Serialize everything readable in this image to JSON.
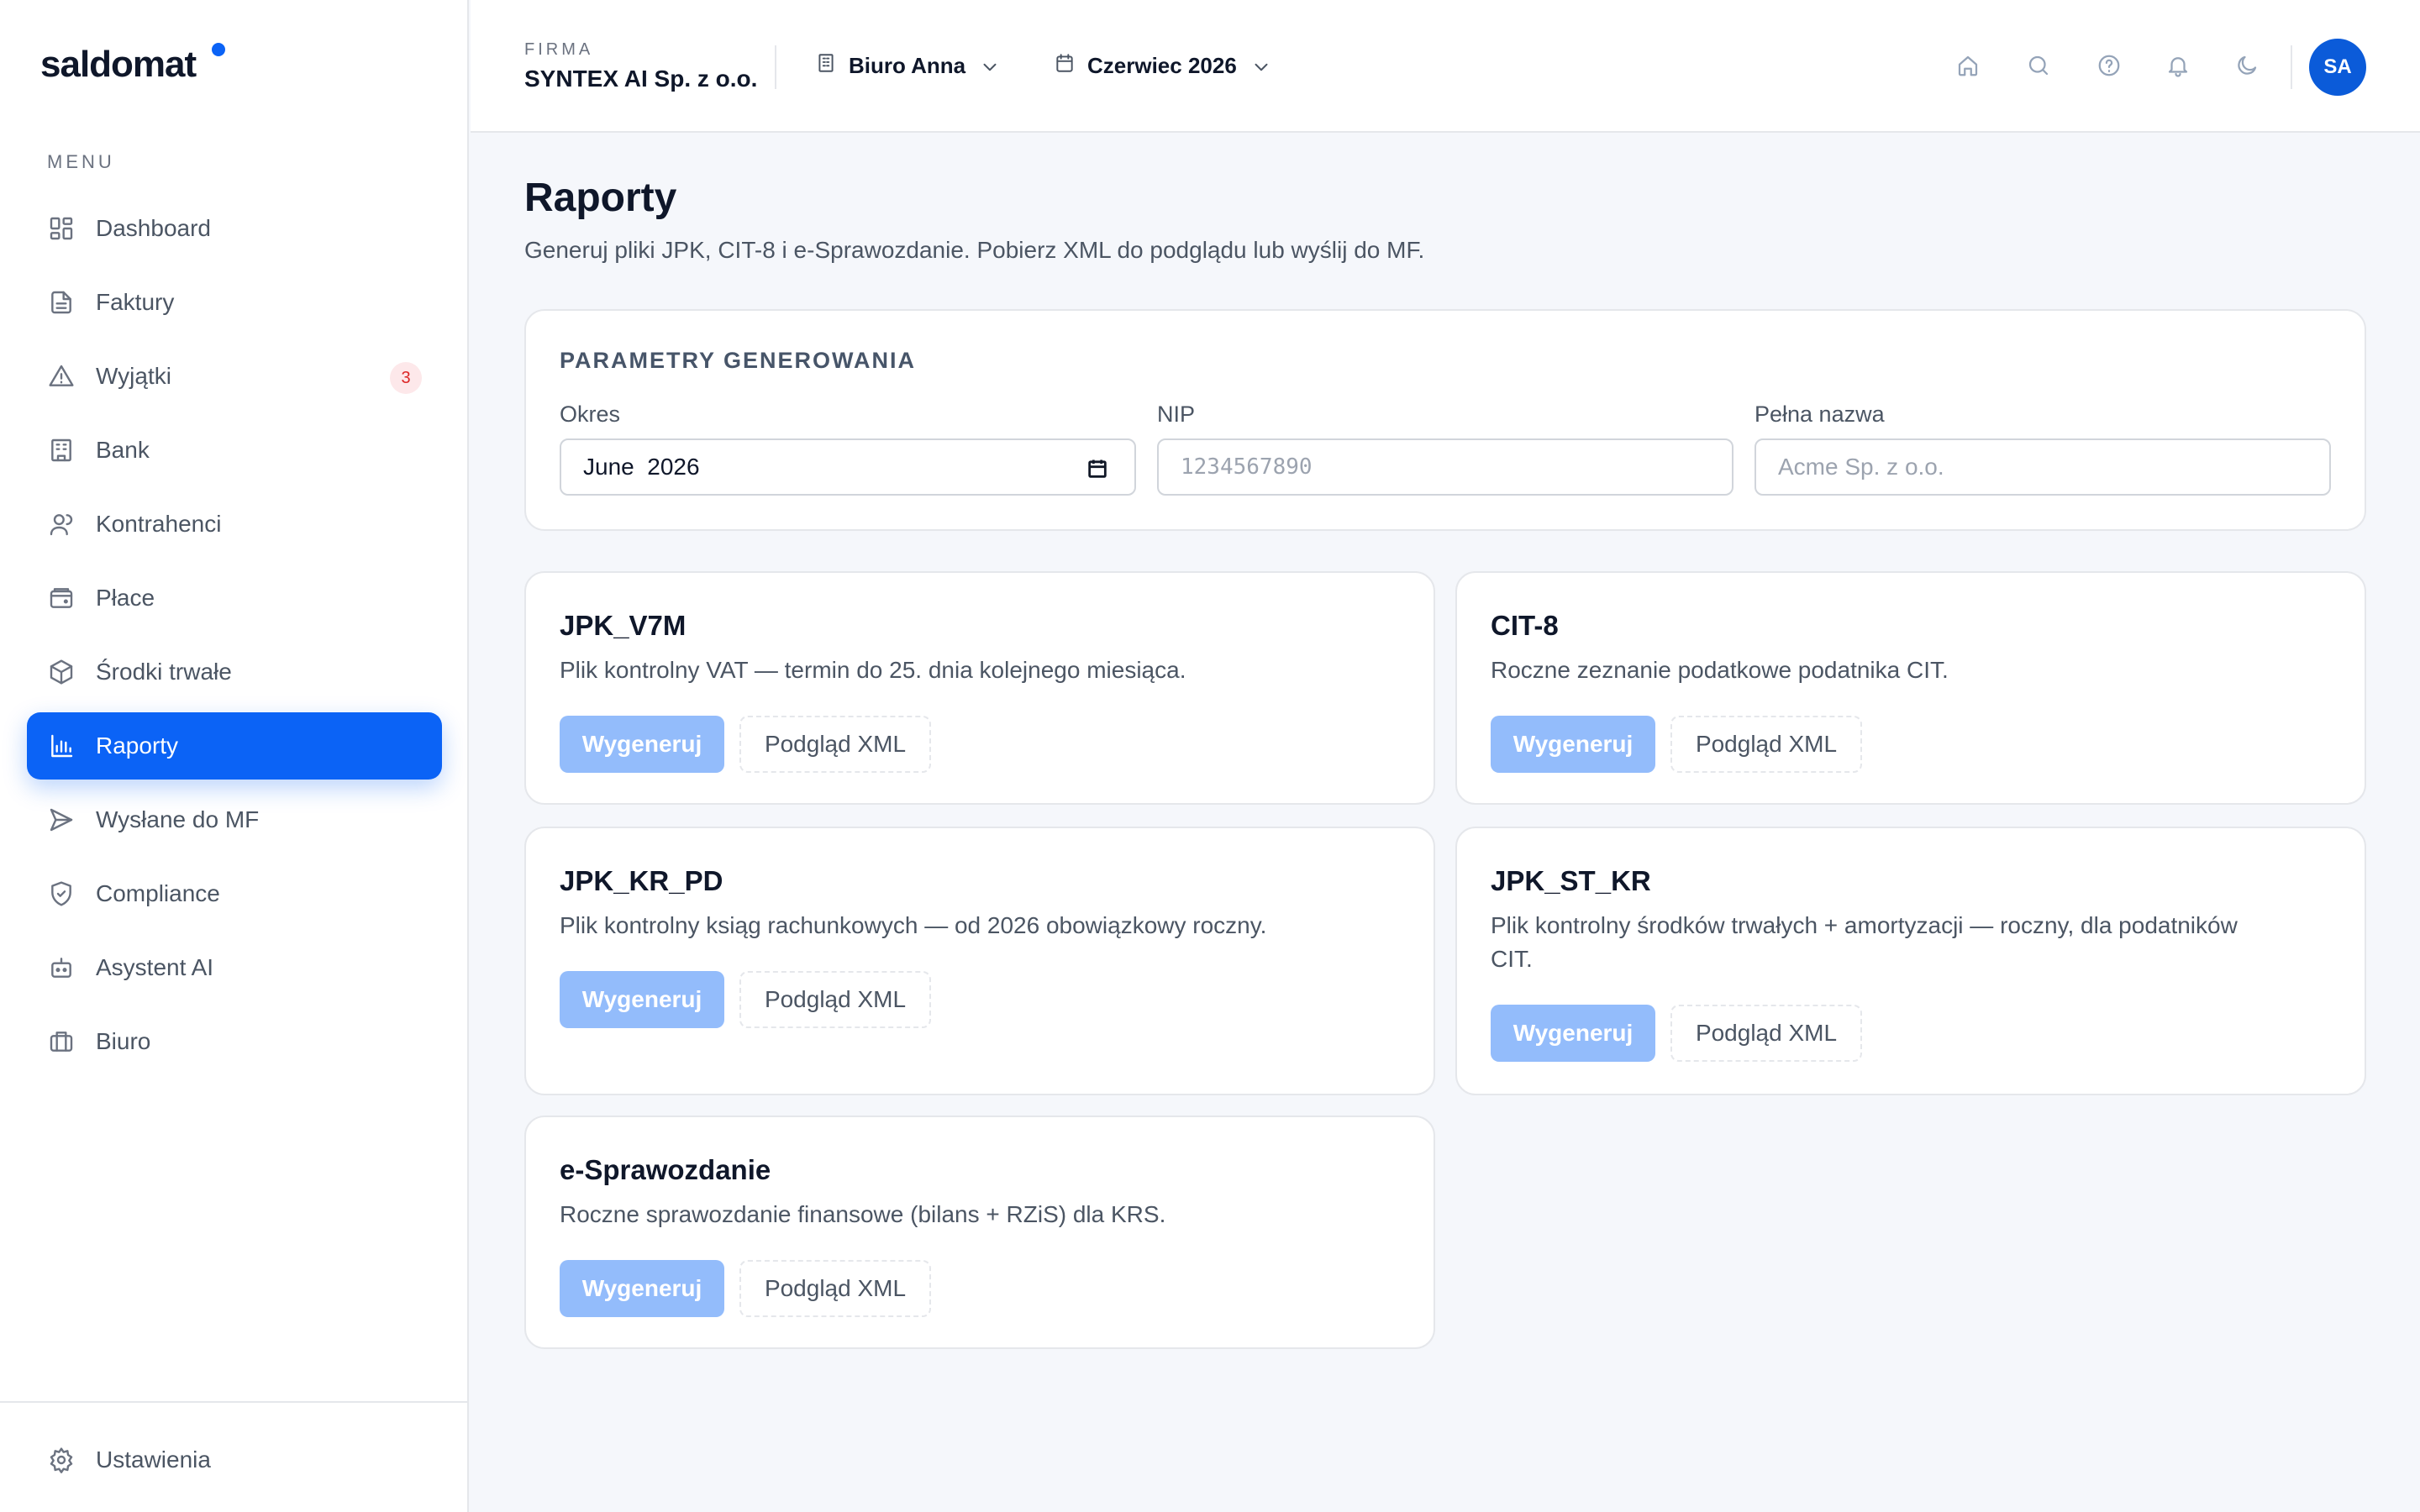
{
  "brand": {
    "name": "saldomat",
    "accent": "#0b63f6"
  },
  "sidebar": {
    "menu_label": "MENU",
    "items": [
      {
        "label": "Dashboard",
        "icon": "grid-icon"
      },
      {
        "label": "Faktury",
        "icon": "document-icon"
      },
      {
        "label": "Wyjątki",
        "icon": "warning-icon",
        "badge": "3"
      },
      {
        "label": "Bank",
        "icon": "bank-icon"
      },
      {
        "label": "Kontrahenci",
        "icon": "users-icon"
      },
      {
        "label": "Płace",
        "icon": "wallet-icon"
      },
      {
        "label": "Środki trwałe",
        "icon": "box-icon"
      },
      {
        "label": "Raporty",
        "icon": "bar-chart-icon",
        "active": true
      },
      {
        "label": "Wysłane do MF",
        "icon": "send-icon"
      },
      {
        "label": "Compliance",
        "icon": "shield-check-icon"
      },
      {
        "label": "Asystent AI",
        "icon": "robot-icon"
      },
      {
        "label": "Biuro",
        "icon": "briefcase-icon"
      }
    ],
    "footer": {
      "label": "Ustawienia",
      "icon": "gear-icon"
    }
  },
  "topbar": {
    "firm_label": "FIRMA",
    "firm_name": "SYNTEX AI Sp. z o.o.",
    "office": "Biuro Anna",
    "period": "Czerwiec 2026",
    "icons": [
      "home-icon",
      "search-icon",
      "help-icon",
      "bell-icon",
      "moon-icon"
    ],
    "avatar": "SA"
  },
  "page": {
    "title": "Raporty",
    "subtitle": "Generuj pliki JPK, CIT-8 i e-Sprawozdanie. Pobierz XML do podglądu lub wyślij do MF."
  },
  "params": {
    "title": "PARAMETRY GENEROWANIA",
    "period_label": "Okres",
    "period_value": "June  2026",
    "nip_label": "NIP",
    "nip_placeholder": "1234567890",
    "name_label": "Pełna nazwa",
    "name_placeholder": "Acme Sp. z o.o."
  },
  "reports": [
    {
      "title": "JPK_V7M",
      "desc": "Plik kontrolny VAT — termin do 25. dnia kolejnego miesiąca.",
      "generate": "Wygeneruj",
      "preview": "Podgląd XML"
    },
    {
      "title": "CIT-8",
      "desc": "Roczne zeznanie podatkowe podatnika CIT.",
      "generate": "Wygeneruj",
      "preview": "Podgląd XML"
    },
    {
      "title": "JPK_KR_PD",
      "desc": "Plik kontrolny ksiąg rachunkowych — od 2026 obowiązkowy roczny.",
      "generate": "Wygeneruj",
      "preview": "Podgląd XML"
    },
    {
      "title": "JPK_ST_KR",
      "desc_line1": "Plik kontrolny środków trwałych + amortyzacji — roczny, dla podatników",
      "desc_line2": "CIT.",
      "generate": "Wygeneruj",
      "preview": "Podgląd XML"
    },
    {
      "title": "e-Sprawozdanie",
      "desc": "Roczne sprawozdanie finansowe (bilans + RZiS) dla KRS.",
      "generate": "Wygeneruj",
      "preview": "Podgląd XML"
    }
  ]
}
